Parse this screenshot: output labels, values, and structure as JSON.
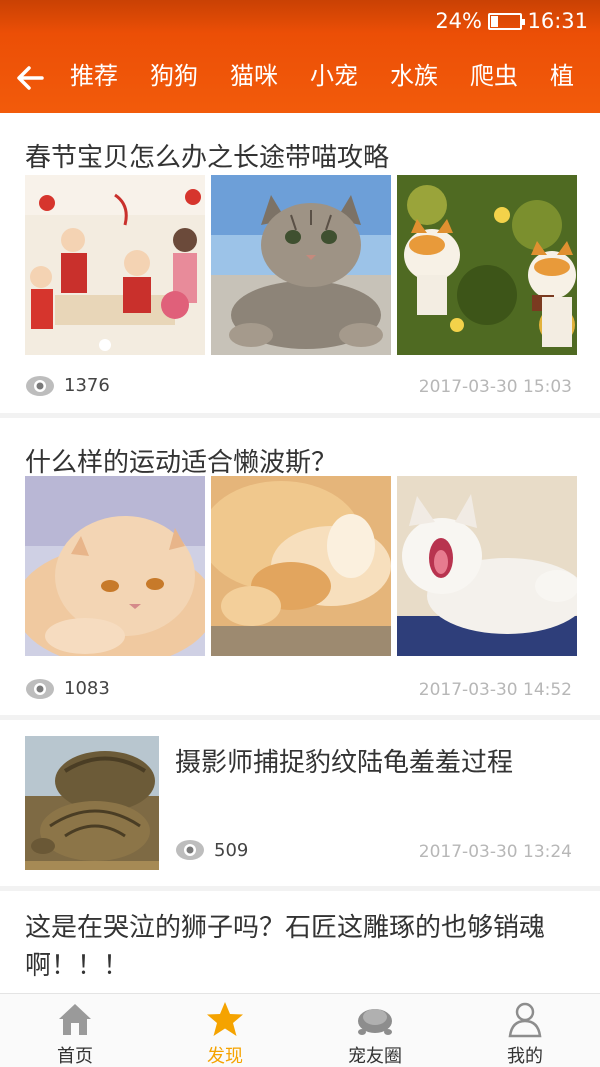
{
  "status": {
    "battery": "24%",
    "battery_level": 0.24,
    "time": "16:31"
  },
  "nav_tabs": [
    "推荐",
    "狗狗",
    "猫咪",
    "小宠",
    "水族",
    "爬虫",
    "植"
  ],
  "articles": [
    {
      "title": "春节宝贝怎么办之长途带喵攻略",
      "views": "1376",
      "date": "2017-03-30 15:03",
      "images": [
        "new-year-cartoon",
        "tabby-cat",
        "two-orange-cats"
      ]
    },
    {
      "title": "什么样的运动适合懒波斯？",
      "views": "1083",
      "date": "2017-03-30 14:52",
      "images": [
        "persian-cat-face",
        "persian-cat-paws",
        "white-persian-yawning"
      ]
    },
    {
      "title": "摄影师捕捉豹纹陆龟羞羞过程",
      "views": "509",
      "date": "2017-03-30 13:24",
      "images": [
        "leopard-tortoises"
      ]
    },
    {
      "title": "这是在哭泣的狮子吗？石匠这雕琢的也够销魂啊！！！"
    }
  ],
  "bottom_nav": [
    {
      "label": "首页",
      "icon": "home-icon"
    },
    {
      "label": "发现",
      "icon": "star-icon"
    },
    {
      "label": "宠友圈",
      "icon": "turtle-icon"
    },
    {
      "label": "我的",
      "icon": "person-icon"
    }
  ],
  "colors": {
    "header": "#f25b0b",
    "active_tab": "#f5a300",
    "date_text": "#b7b7b7"
  }
}
